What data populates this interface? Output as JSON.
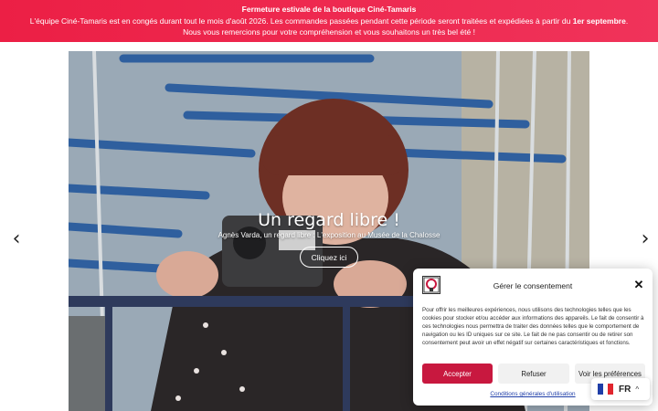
{
  "banner": {
    "title": "Fermeture estivale de la boutique Ciné-Tamaris",
    "line1_start": "L'équipe Ciné-Tamaris est en congés durant tout le mois d'août 2026. Les commandes passées pendant cette période seront traitées et expédiées à partir du ",
    "line1_bold": "1er septembre",
    "line1_end": ".",
    "line2": "Nous vous remercions pour votre compréhension et vous souhaitons un très bel été !"
  },
  "slider": {
    "title": "Un regard libre !",
    "subtitle": "Agnès Varda, un regard libre : L'exposition au Musée de la Chalosse",
    "button_label": "Cliquez ici",
    "prev_arrow": "‹",
    "next_arrow": "›"
  },
  "consent": {
    "title": "Gérer le consentement",
    "close_glyph": "✕",
    "text": "Pour offrir les meilleures expériences, nous utilisons des technologies telles que les cookies pour stocker et/ou accéder aux informations des appareils. Le fait de consentir à ces technologies nous permettra de traiter des données telles que le comportement de navigation ou les ID uniques sur ce site. Le fait de ne pas consentir ou de retirer son consentement peut avoir un effet négatif sur certaines caractéristiques et fonctions.",
    "accept_label": "Accepter",
    "refuse_label": "Refuser",
    "prefs_label": "Voir les préférences",
    "link_label": "Conditions générales d'utilisation"
  },
  "language": {
    "label": "FR",
    "caret": "^"
  },
  "colors": {
    "banner": "#ec1f45",
    "accept_button": "#c8183f",
    "link": "#1f3ea8"
  },
  "icons": {
    "prev": "chevron-left-icon",
    "next": "chevron-right-icon",
    "close": "close-icon",
    "flag": "french-flag-icon",
    "logo": "cine-tamaris-logo"
  }
}
